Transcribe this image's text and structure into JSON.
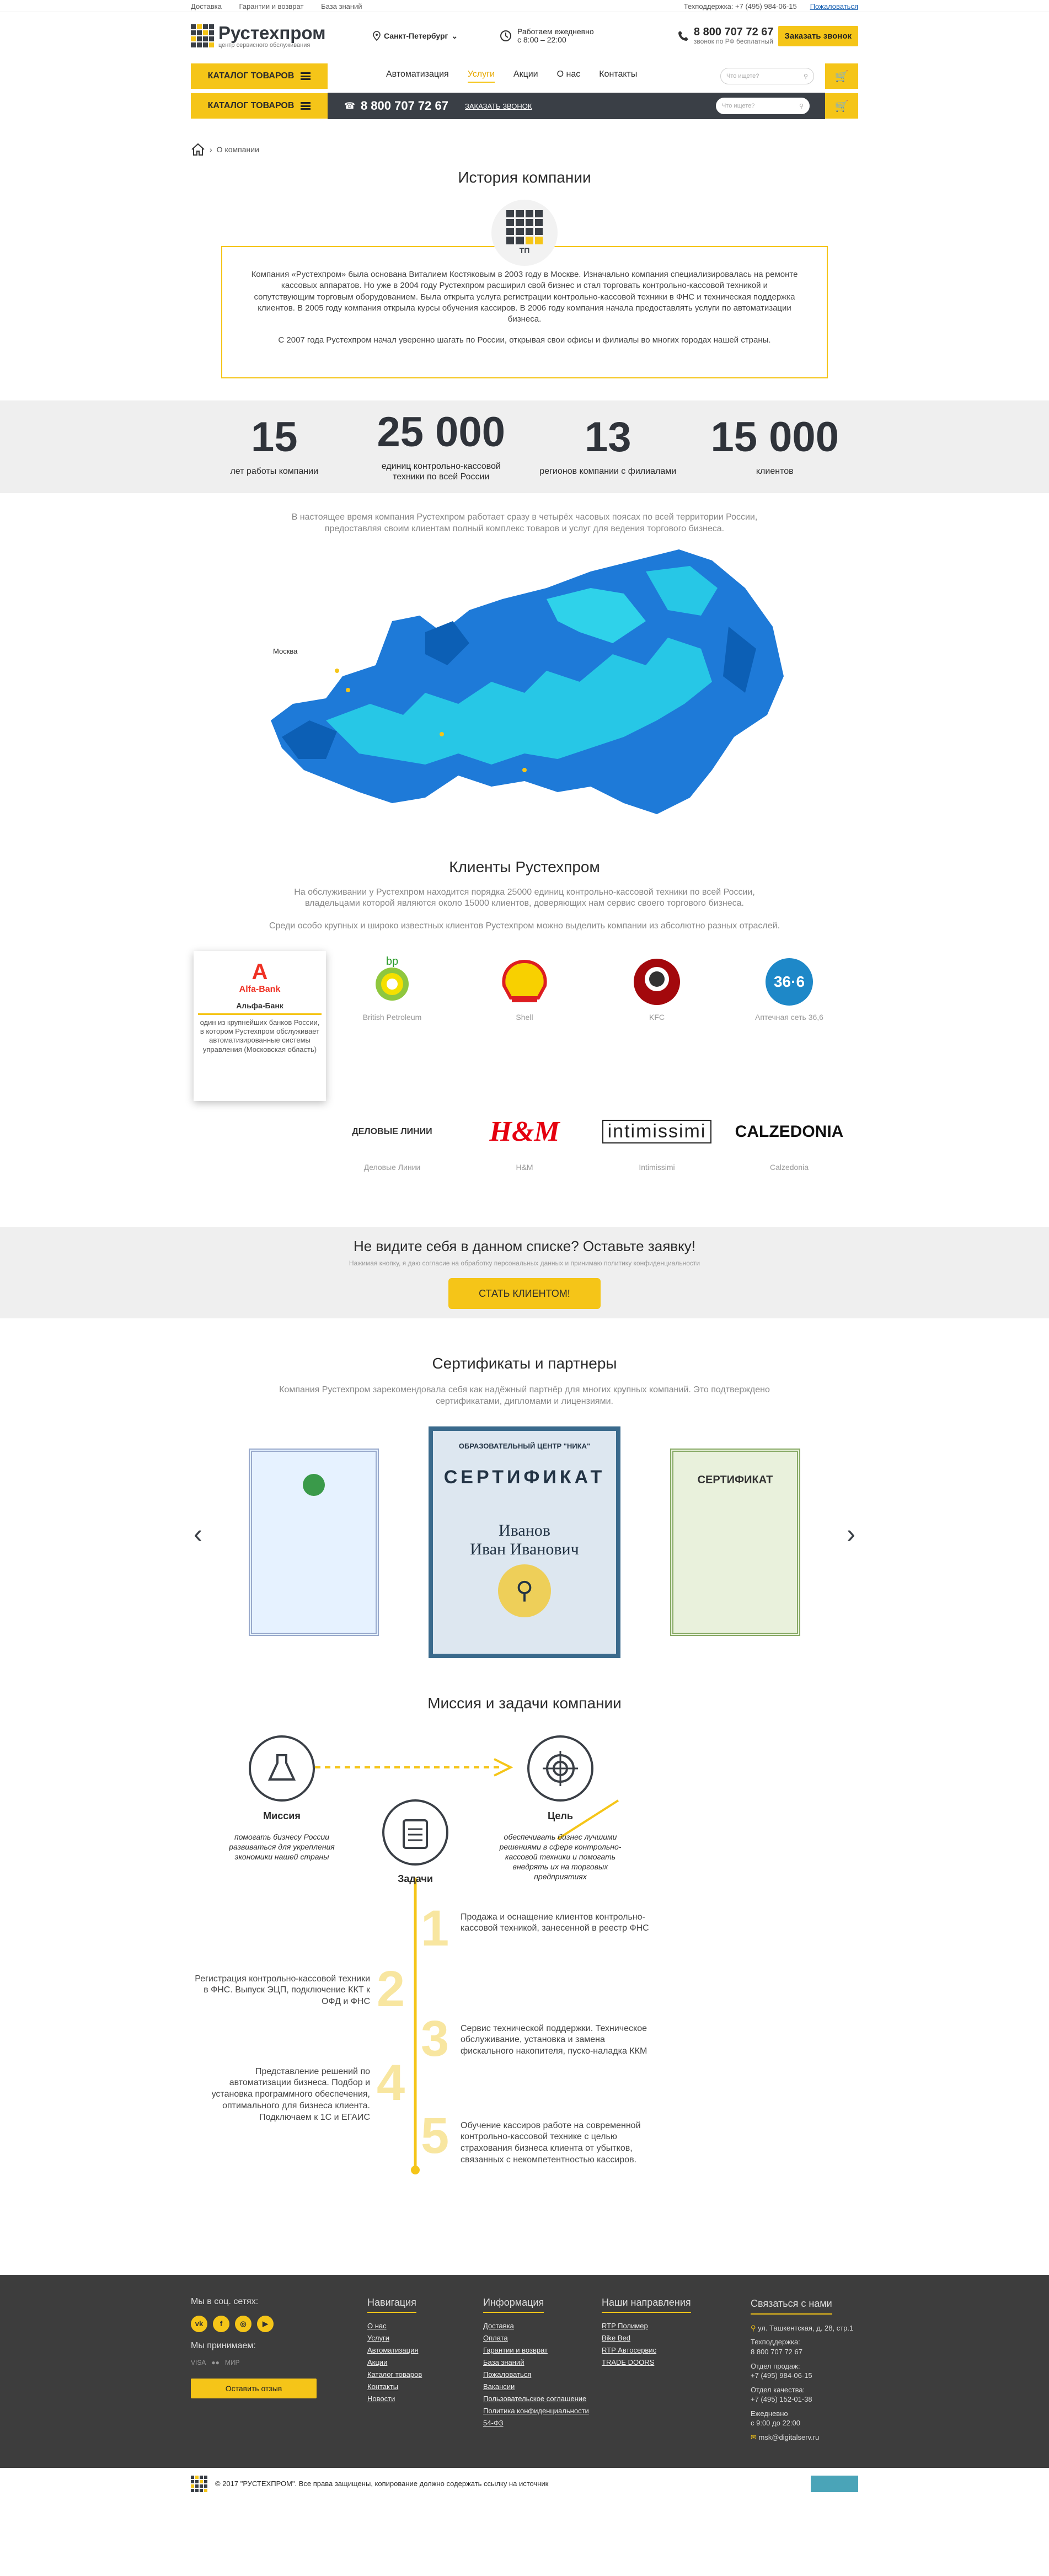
{
  "topbar": {
    "links": [
      "Доставка",
      "Гарантии и возврат",
      "База знаний"
    ],
    "support": "Техподдержка: +7 (495) 984-06-15",
    "complain": "Пожаловаться"
  },
  "header": {
    "brand": "Рустехпром",
    "tagline": "центр сервисного обслуживания",
    "city": "Санкт-Петербург",
    "hours_line1": "Работаем ежедневно",
    "hours_line2": "с 8:00 – 22:00",
    "phone": "8 800 707 72 67",
    "phone_note": "звонок по РФ бесплатный",
    "call_btn": "Заказать звонок"
  },
  "nav": {
    "catalog": "КАТАЛОГ ТОВАРОВ",
    "items": [
      "Автоматизация",
      "Услуги",
      "Акции",
      "О нас",
      "Контакты"
    ],
    "search_placeholder": "Что ищете?",
    "sticky_phone": "8 800 707 72 67",
    "sticky_call": "ЗАКАЗАТЬ ЗВОНОК"
  },
  "breadcrumb": {
    "current": "О компании"
  },
  "history": {
    "title": "История компании",
    "logo_text": "ТП",
    "p1": "Компания «Рустехпром» была основана Виталием Костяковым в 2003 году в Москве. Изначально компания специализировалась на ремонте кассовых аппаратов. Но уже в 2004 году Рустехпром расширил свой бизнес и стал торговать контрольно-кассовой техникой и сопутствующим торговым оборудованием. Была открыта услуга регистрации контрольно-кассовой техники в ФНС и техническая поддержка клиентов. В 2005 году компания открыла курсы обучения кассиров. В 2006 году компания начала предоставлять услуги по автоматизации бизнеса.",
    "p2": "С 2007 года Рустехпром начал уверенно шагать по России, открывая свои офисы и филиалы во многих городах нашей страны."
  },
  "stats": [
    {
      "num": "15",
      "label": "лет работы компании"
    },
    {
      "num": "25 000",
      "label": "единиц контрольно-кассовой техники по всей России"
    },
    {
      "num": "13",
      "label": "регионов компании с филиалами"
    },
    {
      "num": "15 000",
      "label": "клиентов"
    }
  ],
  "map": {
    "intro": "В настоящее время компания Рустехпром работает сразу в четырёх часовых поясах по всей территории России, предоставляя своим клиентам полный комплекс товаров и услуг для ведения торгового бизнеса.",
    "label": "Москва"
  },
  "clients": {
    "title": "Клиенты Рустехпром",
    "text1": "На обслуживании у Рустехпром находится порядка 25000 единиц контрольно-кассовой техники по всей России, владельцами которой являются около 15000 клиентов, доверяющих нам сервис своего торгового бизнеса.",
    "text2": "Среди особо крупных и широко известных клиентов Рустехпром можно выделить компании из абсолютно разных отраслей.",
    "items": [
      {
        "name": "Альфа-Банк",
        "logo": "Alfa-Bank",
        "desc": "один из крупнейших банков России, в котором Рустехпром обслуживает автоматизированные системы управления (Московская область)"
      },
      {
        "name": "British Petroleum",
        "logo": "bp"
      },
      {
        "name": "Shell",
        "logo": "Shell"
      },
      {
        "name": "KFC",
        "logo": "KFC"
      },
      {
        "name": "Аптечная сеть 36,6",
        "logo": "36·6"
      },
      {
        "name": "Деловые Линии",
        "logo": "ДЕЛОВЫЕ ЛИНИИ"
      },
      {
        "name": "H&M",
        "logo": "H&M"
      },
      {
        "name": "Intimissimi",
        "logo": "intimissimi"
      },
      {
        "name": "Calzedonia",
        "logo": "CALZEDONIA"
      }
    ]
  },
  "cta": {
    "title": "Не видите себя в данном списке? Оставьте заявку!",
    "note": "Нажимая кнопку, я даю согласие на обработку персональных данных и принимаю политику конфиденциальности",
    "button": "СТАТЬ КЛИЕНТОМ!"
  },
  "certs": {
    "title": "Сертификаты и партнеры",
    "text": "Компания Рустехпром зарекомендовала себя как надёжный партнёр для многих крупных компаний. Это подтверждено сертификатами, дипломами и лицензиями.",
    "main_head": "ОБРАЗОВАТЕЛЬНЫЙ ЦЕНТР \"НИКА\"",
    "main_title": "СЕРТИФИКАТ",
    "main_name": "Иванов",
    "main_name2": "Иван Иванович",
    "right_title": "СЕРТИФИКАТ"
  },
  "mission": {
    "title": "Миссия и задачи компании",
    "mission_label": "Миссия",
    "mission_text": "помогать бизнесу России развиваться для укрепления экономики нашей страны",
    "goal_label": "Цель",
    "goal_text": "обеспечивать бизнес лучшими решениями в сфере контрольно-кассовой техники и помогать внедрять их на торговых предприятиях",
    "tasks_label": "Задачи",
    "tasks": [
      {
        "n": "1",
        "text": "Продажа и оснащение клиентов контрольно-кассовой техникой, занесенной в реестр ФНС"
      },
      {
        "n": "2",
        "text": "Регистрация контрольно-кассовой техники в ФНС. Выпуск ЭЦП, подключение ККТ к ОФД и ФНС"
      },
      {
        "n": "3",
        "text": "Сервис технической поддержки. Техническое обслуживание, установка и замена фискального накопителя, пуско-наладка ККМ"
      },
      {
        "n": "4",
        "text": "Представление решений по автоматизации бизнеса. Подбор и установка программного обеспечения, оптимального для бизнеса клиента. Подключаем к 1С и ЕГАИС"
      },
      {
        "n": "5",
        "text": "Обучение кассиров работе на современной контрольно-кассовой технике с целью страхования бизнеса клиента от убытков, связанных с некомпетентностью кассиров."
      }
    ]
  },
  "footer": {
    "social": "Мы в соц. сетях:",
    "accept": "Мы принимаем:",
    "feedback": "Оставить отзыв",
    "nav_title": "Навигация",
    "nav": [
      "О нас",
      "Услуги",
      "Автоматизация",
      "Акции",
      "Каталог товаров",
      "Контакты",
      "Новости"
    ],
    "info_title": "Информация",
    "info": [
      "Доставка",
      "Оплата",
      "Гарантии и возврат",
      "База знаний",
      "Пожаловаться",
      "Вакансии",
      "Пользовательское соглашение",
      "Политика конфиденциальности",
      "54-ФЗ"
    ],
    "dir_title": "Наши направления",
    "dirs": [
      "RTP Полимер",
      "Bike Bed",
      "RTP Автосервис",
      "TRADE DOORS"
    ],
    "contact_title": "Связаться с нами",
    "address": "ул. Ташкентская, д. 28, стр.1",
    "support_label": "Техподдержка:",
    "support_phone": "8 800 707 72 67",
    "sales_label": "Отдел продаж:",
    "sales_phone": "+7 (495) 984-06-15",
    "quality_label": "Отдел качества:",
    "quality_phone": "+7 (495) 152-01-38",
    "daily": "Ежедневно",
    "daily_hours": "с 9:00 до 22:00",
    "email": "msk@digitalserv.ru"
  },
  "copyright": "© 2017 \"РУСТЕХПРОМ\". Все права защищены, копирование должно содержать ссылку на источник",
  "colors": {
    "accent": "#f5c518",
    "dark": "#3a3f46",
    "map_blue": "#1e7ad8",
    "map_cyan": "#27c7e6"
  }
}
